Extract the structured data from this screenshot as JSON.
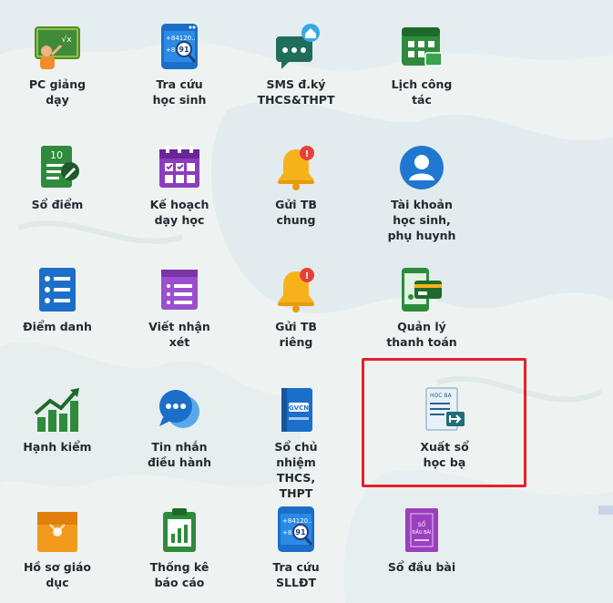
{
  "tiles": [
    {
      "label": "PC giảng\ndạy",
      "icon": "teacher-board-icon"
    },
    {
      "label": "Tra cứu\nhọc sinh",
      "icon": "phone-search-icon"
    },
    {
      "label": "SMS đ.ký\nTHCS&THPT",
      "icon": "sms-home-icon"
    },
    {
      "label": "Lịch công\ntác",
      "icon": "calendar-icon"
    },
    {
      "label": "Sổ điểm",
      "icon": "gradebook-icon"
    },
    {
      "label": "Kế hoạch\ndạy học",
      "icon": "planner-icon"
    },
    {
      "label": "Gửi TB\nchung",
      "icon": "bell-notification-icon"
    },
    {
      "label": "Tài khoản\nhọc sinh,\nphụ huynh",
      "icon": "user-account-icon"
    },
    {
      "label": "Điểm danh",
      "icon": "attendance-list-icon"
    },
    {
      "label": "Viết nhận\nxét",
      "icon": "comment-note-icon"
    },
    {
      "label": "Gửi TB\nriêng",
      "icon": "bell-notification-icon"
    },
    {
      "label": "Quản lý\nthanh toán",
      "icon": "payment-phone-icon"
    },
    {
      "label": "Hạnh kiểm",
      "icon": "trend-chart-icon"
    },
    {
      "label": "Tin nhắn\nđiều hành",
      "icon": "chat-bubbles-icon"
    },
    {
      "label": "Sổ chủ\nnhiệm\nTHCS,\nTHPT",
      "icon": "homeroom-book-icon"
    },
    {
      "label": "Xuất sổ\nhọc bạ",
      "icon": "report-export-icon"
    },
    {
      "label": "Hồ sơ giáo\ndục",
      "icon": "folder-icon"
    },
    {
      "label": "Thống kê\nbáo cáo",
      "icon": "clipboard-chart-icon"
    },
    {
      "label": "Tra cứu\nSLLĐT",
      "icon": "phone-search-icon"
    },
    {
      "label": "Sổ đầu bài",
      "icon": "class-log-book-icon"
    }
  ],
  "icon_text": {
    "board": "√x",
    "phone_number": "+84120...\n+84 91",
    "gradebook_number": "10",
    "homeroom_badge": "GVCN",
    "report_tag": "HỌC BẠ",
    "logbook_title": "SỔ\nĐẦU BÀI"
  },
  "colors": {
    "highlight": "#e5202a",
    "label": "#222a30"
  }
}
